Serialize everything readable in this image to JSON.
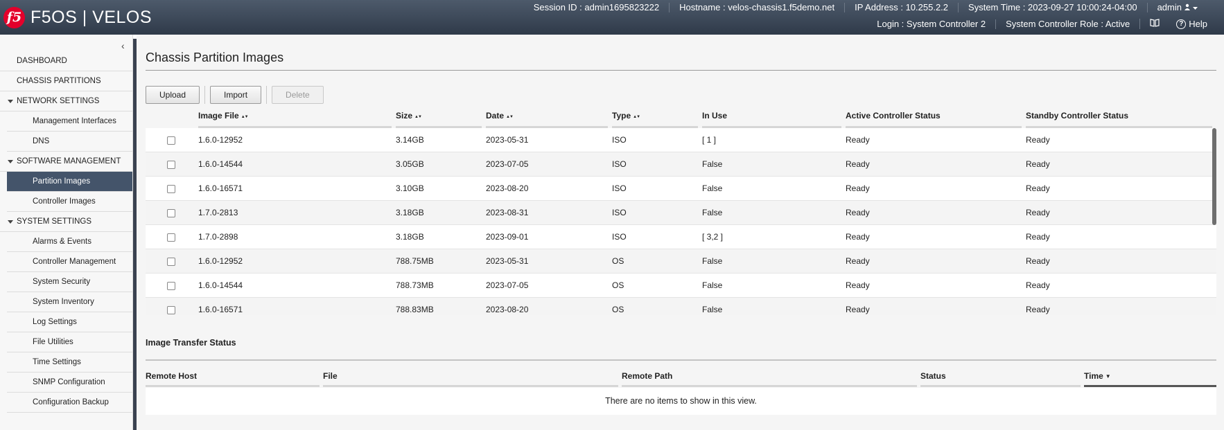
{
  "header": {
    "brand": "F5OS | VELOS",
    "logo": "f5",
    "session_id": "Session ID : admin1695823222",
    "hostname": "Hostname : velos-chassis1.f5demo.net",
    "ip_address": "IP Address : 10.255.2.2",
    "system_time": "System Time : 2023-09-27 10:00:24-04:00",
    "user": "admin",
    "login": "Login : System Controller 2",
    "role": "System Controller Role : Active",
    "help": "Help"
  },
  "sidebar": {
    "items": [
      {
        "label": "DASHBOARD",
        "kind": "head"
      },
      {
        "label": "CHASSIS PARTITIONS",
        "kind": "head"
      },
      {
        "label": "NETWORK SETTINGS",
        "kind": "section"
      },
      {
        "label": "Management Interfaces",
        "kind": "sub"
      },
      {
        "label": "DNS",
        "kind": "sub"
      },
      {
        "label": "SOFTWARE MANAGEMENT",
        "kind": "section"
      },
      {
        "label": "Partition Images",
        "kind": "sub",
        "active": true
      },
      {
        "label": "Controller Images",
        "kind": "sub"
      },
      {
        "label": "SYSTEM SETTINGS",
        "kind": "section"
      },
      {
        "label": "Alarms & Events",
        "kind": "sub"
      },
      {
        "label": "Controller Management",
        "kind": "sub"
      },
      {
        "label": "System Security",
        "kind": "sub"
      },
      {
        "label": "System Inventory",
        "kind": "sub"
      },
      {
        "label": "Log Settings",
        "kind": "sub"
      },
      {
        "label": "File Utilities",
        "kind": "sub"
      },
      {
        "label": "Time Settings",
        "kind": "sub"
      },
      {
        "label": "SNMP Configuration",
        "kind": "sub"
      },
      {
        "label": "Configuration Backup",
        "kind": "sub"
      }
    ]
  },
  "main": {
    "title": "Chassis Partition Images",
    "buttons": {
      "upload": "Upload",
      "import": "Import",
      "delete": "Delete"
    },
    "columns": [
      "Image File",
      "Size",
      "Date",
      "Type",
      "In Use",
      "Active Controller Status",
      "Standby Controller Status"
    ],
    "rows": [
      [
        "1.6.0-12952",
        "3.14GB",
        "2023-05-31",
        "ISO",
        "[ 1 ]",
        "Ready",
        "Ready"
      ],
      [
        "1.6.0-14544",
        "3.05GB",
        "2023-07-05",
        "ISO",
        "False",
        "Ready",
        "Ready"
      ],
      [
        "1.6.0-16571",
        "3.10GB",
        "2023-08-20",
        "ISO",
        "False",
        "Ready",
        "Ready"
      ],
      [
        "1.7.0-2813",
        "3.18GB",
        "2023-08-31",
        "ISO",
        "False",
        "Ready",
        "Ready"
      ],
      [
        "1.7.0-2898",
        "3.18GB",
        "2023-09-01",
        "ISO",
        "[ 3,2 ]",
        "Ready",
        "Ready"
      ],
      [
        "1.6.0-12952",
        "788.75MB",
        "2023-05-31",
        "OS",
        "False",
        "Ready",
        "Ready"
      ],
      [
        "1.6.0-14544",
        "788.73MB",
        "2023-07-05",
        "OS",
        "False",
        "Ready",
        "Ready"
      ],
      [
        "1.6.0-16571",
        "788.83MB",
        "2023-08-20",
        "OS",
        "False",
        "Ready",
        "Ready"
      ]
    ],
    "transfer": {
      "title": "Image Transfer Status",
      "columns": [
        "Remote Host",
        "File",
        "Remote Path",
        "Status",
        "Time"
      ],
      "empty": "There are no items to show in this view."
    }
  }
}
